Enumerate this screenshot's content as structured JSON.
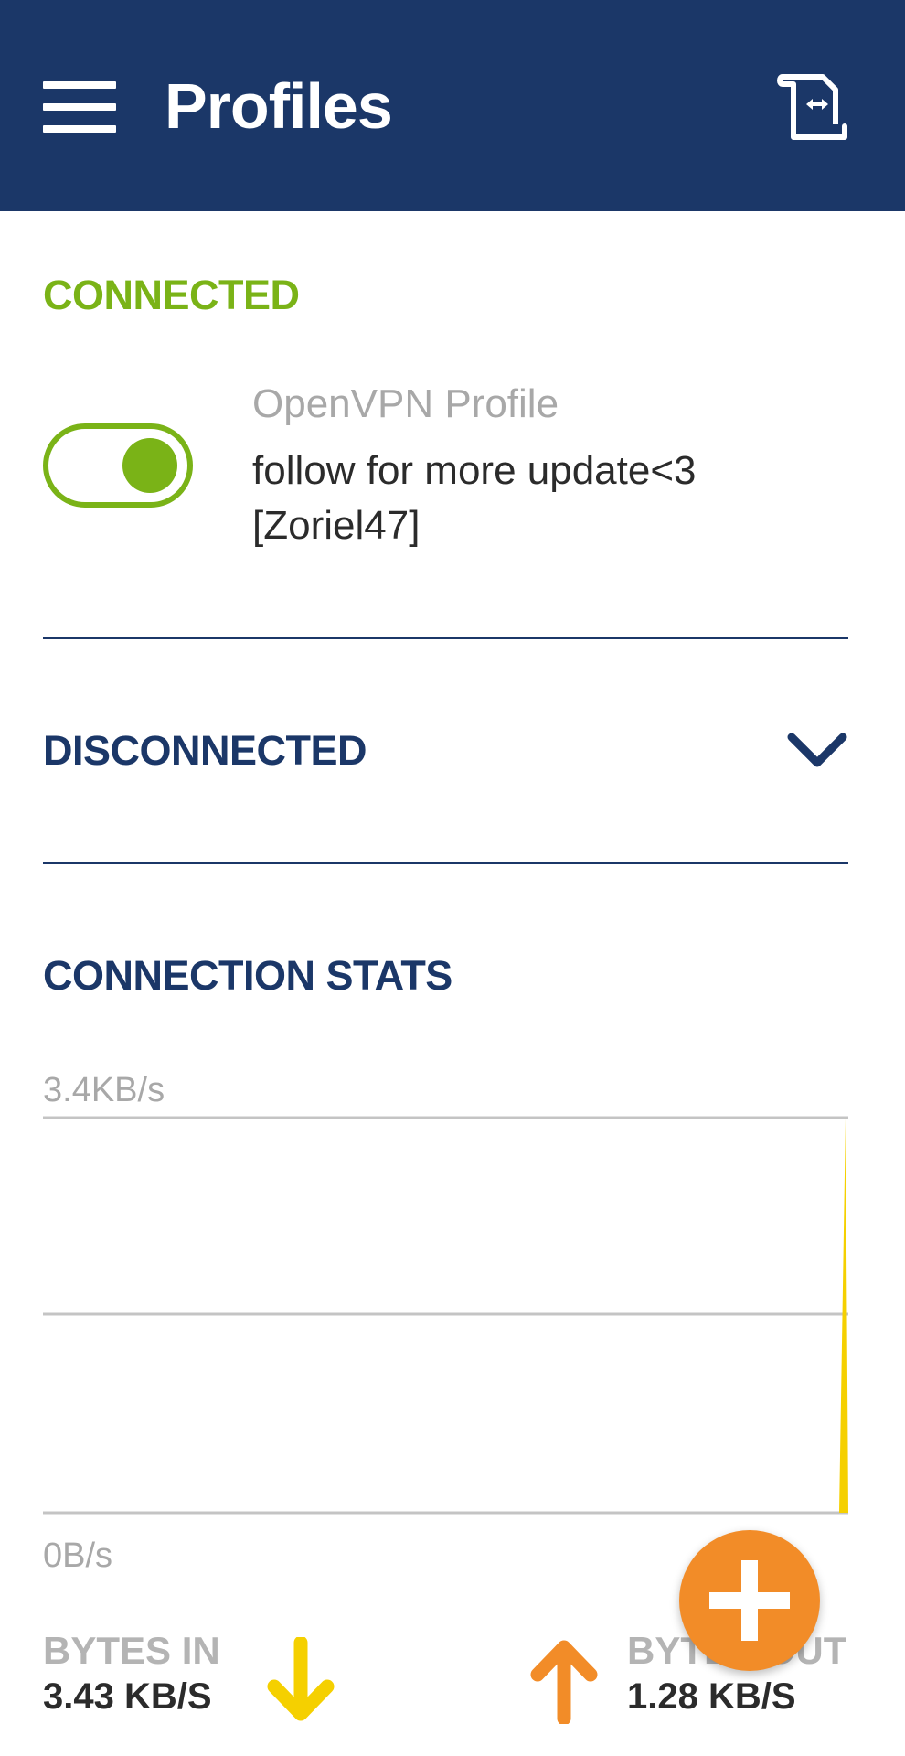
{
  "colors": {
    "header_bg": "#1b3768",
    "connected_green": "#7ab317",
    "navy": "#1b3768",
    "chart_in": "#f5d000",
    "bytes_out_orange": "#f28c28",
    "fab_orange": "#f28c28"
  },
  "header": {
    "title": "Profiles",
    "menu_icon": "hamburger-menu-icon",
    "import_icon": "import-profile-icon"
  },
  "connected": {
    "section_label": "CONNECTED",
    "toggle_on": true,
    "profile_type": "OpenVPN Profile",
    "profile_name": "follow for more update<3 [Zoriel47]"
  },
  "disconnected": {
    "section_label": "DISCONNECTED",
    "expand_icon": "chevron-down-icon"
  },
  "stats": {
    "section_label": "CONNECTION STATS",
    "chart_data": {
      "type": "area",
      "title": "",
      "xlabel": "",
      "ylabel": "",
      "ylim_labels": [
        "0B/s",
        "3.4KB/s"
      ],
      "ylim": [
        0,
        3.4
      ],
      "yunit": "KB/s",
      "grid": true,
      "series": [
        {
          "name": "BYTES IN",
          "values": [
            0,
            0,
            0,
            0,
            0,
            0,
            0,
            0,
            0,
            0,
            0,
            0,
            0,
            0,
            0,
            0,
            0,
            0,
            0,
            0,
            0,
            0,
            0,
            0,
            0,
            0,
            0,
            0,
            0,
            0,
            0,
            0,
            0,
            0,
            0,
            0,
            0,
            0,
            0,
            0,
            0,
            0,
            0,
            0,
            0,
            0,
            0,
            0,
            0,
            3.43
          ]
        }
      ]
    },
    "bytes_in": {
      "label": "BYTES IN",
      "value": "3.43 KB/S",
      "icon": "arrow-down-icon"
    },
    "bytes_out": {
      "label": "BYTES OUT",
      "value": "1.28 KB/S",
      "icon": "arrow-up-icon"
    }
  },
  "fab": {
    "icon": "plus-icon"
  }
}
